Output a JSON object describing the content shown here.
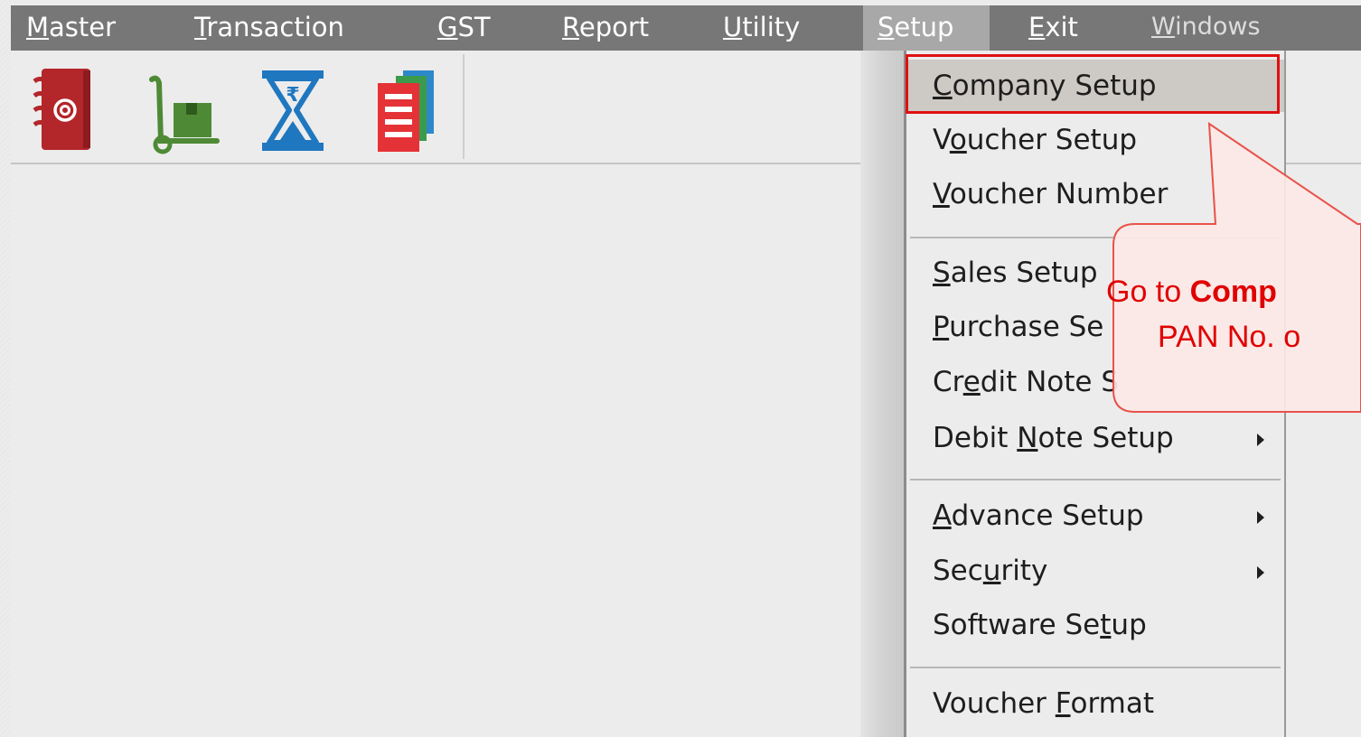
{
  "menubar": {
    "items": [
      {
        "label": "Master",
        "mnemonic": "M",
        "rest": "aster"
      },
      {
        "label": "Transaction",
        "mnemonic": "T",
        "rest": "ransaction"
      },
      {
        "label": "GST",
        "mnemonic": "G",
        "rest": "ST"
      },
      {
        "label": "Report",
        "mnemonic": "R",
        "rest": "eport"
      },
      {
        "label": "Utility",
        "mnemonic": "U",
        "rest": "tility"
      },
      {
        "label": "Setup",
        "mnemonic": "S",
        "rest": "etup"
      },
      {
        "label": "Exit",
        "mnemonic": "E",
        "rest": "xit"
      },
      {
        "label": "Windows",
        "mnemonic": "W",
        "rest": "indows"
      }
    ],
    "active": "Setup"
  },
  "toolbar": {
    "icons": [
      "contacts-book-icon",
      "hand-truck-icon",
      "rupee-hourglass-icon",
      "documents-stack-icon"
    ]
  },
  "dropdown": {
    "items": [
      {
        "pre": "",
        "mn": "C",
        "post": "ompany Setup",
        "submenu": false
      },
      {
        "pre": "V",
        "mn": "o",
        "post": "ucher Setup",
        "submenu": false
      },
      {
        "pre": "",
        "mn": "V",
        "post": "oucher Number",
        "submenu": false
      },
      {
        "pre": "",
        "mn": "S",
        "post": "ales Setup",
        "submenu": false
      },
      {
        "pre": "",
        "mn": "P",
        "post": "urchase Se",
        "submenu": false
      },
      {
        "pre": "Cr",
        "mn": "e",
        "post": "dit Note S",
        "submenu": false
      },
      {
        "pre": "Debit ",
        "mn": "N",
        "post": "ote Setup",
        "submenu": true
      },
      {
        "pre": "",
        "mn": "A",
        "post": "dvance Setup",
        "submenu": true
      },
      {
        "pre": "Sec",
        "mn": "u",
        "post": "rity",
        "submenu": true
      },
      {
        "pre": "Software Se",
        "mn": "t",
        "post": "up",
        "submenu": false
      },
      {
        "pre": "Voucher ",
        "mn": "F",
        "post": "ormat",
        "submenu": false
      }
    ]
  },
  "callout": {
    "line1_pre": "Go to ",
    "line1_bold": "Comp",
    "line2": "PAN No. o"
  },
  "colors": {
    "menubar_bg": "#777777",
    "active_menu_bg": "#a8a8a8",
    "highlight_border": "#e01010",
    "callout_text": "#e00000",
    "callout_bg": "#fce8e6"
  }
}
